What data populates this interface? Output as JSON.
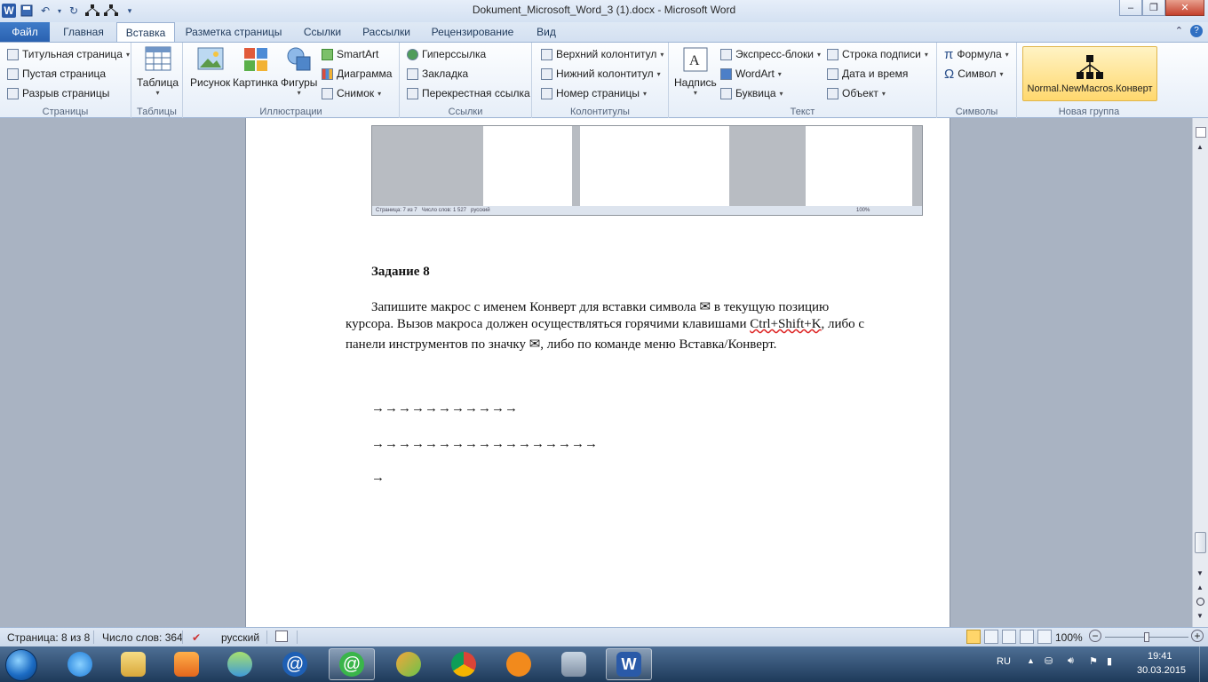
{
  "window": {
    "title": "Dokument_Microsoft_Word_3 (1).docx - Microsoft Word",
    "minimize": "–",
    "maximize": "❐",
    "close": "✕"
  },
  "tabs": [
    {
      "label": "Файл"
    },
    {
      "label": "Главная"
    },
    {
      "label": "Вставка"
    },
    {
      "label": "Разметка страницы"
    },
    {
      "label": "Ссылки"
    },
    {
      "label": "Рассылки"
    },
    {
      "label": "Рецензирование"
    },
    {
      "label": "Вид"
    }
  ],
  "ribbon": {
    "pages": {
      "label": "Страницы",
      "cover": "Титульная страница",
      "blank": "Пустая страница",
      "pagebreak": "Разрыв страницы"
    },
    "tables": {
      "label": "Таблицы",
      "table": "Таблица"
    },
    "illustrations": {
      "label": "Иллюстрации",
      "picture": "Рисунок",
      "clipart": "Картинка",
      "shapes": "Фигуры",
      "smartart": "SmartArt",
      "chart": "Диаграмма",
      "screenshot": "Снимок"
    },
    "links": {
      "label": "Ссылки",
      "hyperlink": "Гиперссылка",
      "bookmark": "Закладка",
      "crossref": "Перекрестная ссылка"
    },
    "headerfooter": {
      "label": "Колонтитулы",
      "header": "Верхний колонтитул",
      "footer": "Нижний колонтитул",
      "pagenum": "Номер страницы"
    },
    "text": {
      "label": "Текст",
      "textbox": "Надпись",
      "quickparts": "Экспресс-блоки",
      "wordart": "WordArt",
      "dropcap": "Буквица",
      "signature": "Строка подписи",
      "datetime": "Дата и время",
      "object": "Объект"
    },
    "symbols": {
      "label": "Символы",
      "equation": "Формула",
      "symbol": "Символ"
    },
    "newgroup": {
      "label": "Новая группа",
      "macro": "Normal.NewMacros.Конверт"
    }
  },
  "document": {
    "thumb_status": {
      "page": "Страница: 7 из 7",
      "words": "Число слов: 1 527",
      "lang": "русский",
      "zoom": "100%"
    },
    "heading": "Задание 8",
    "line1": "Запишите макрос с именем Конверт для вставки символа ✉ в текущую позицию",
    "line2a": "курсора. Вызов макроса  должен осуществляться  горячими клавишами ",
    "line2b": "Ctrl+Shift+K",
    "line2c": ", либо с",
    "line3": "панели инструментов по значку ✉, либо по команде меню Вставка/Конверт.",
    "arrows1": "→→→→→→→→→→→",
    "arrows2": "→→→→→→→→→→→→→→→→→",
    "arrows3": "→"
  },
  "statusbar": {
    "page": "Страница: 8 из 8",
    "words": "Число слов: 364",
    "lang": "русский",
    "zoom": "100%",
    "zoom_level": 0.5
  },
  "taskbar": {
    "lang": "RU",
    "time": "19:41",
    "date": "30.03.2015"
  },
  "colors": {
    "accent": "#2a61b0",
    "macro_highlight": "#ffd86e"
  }
}
